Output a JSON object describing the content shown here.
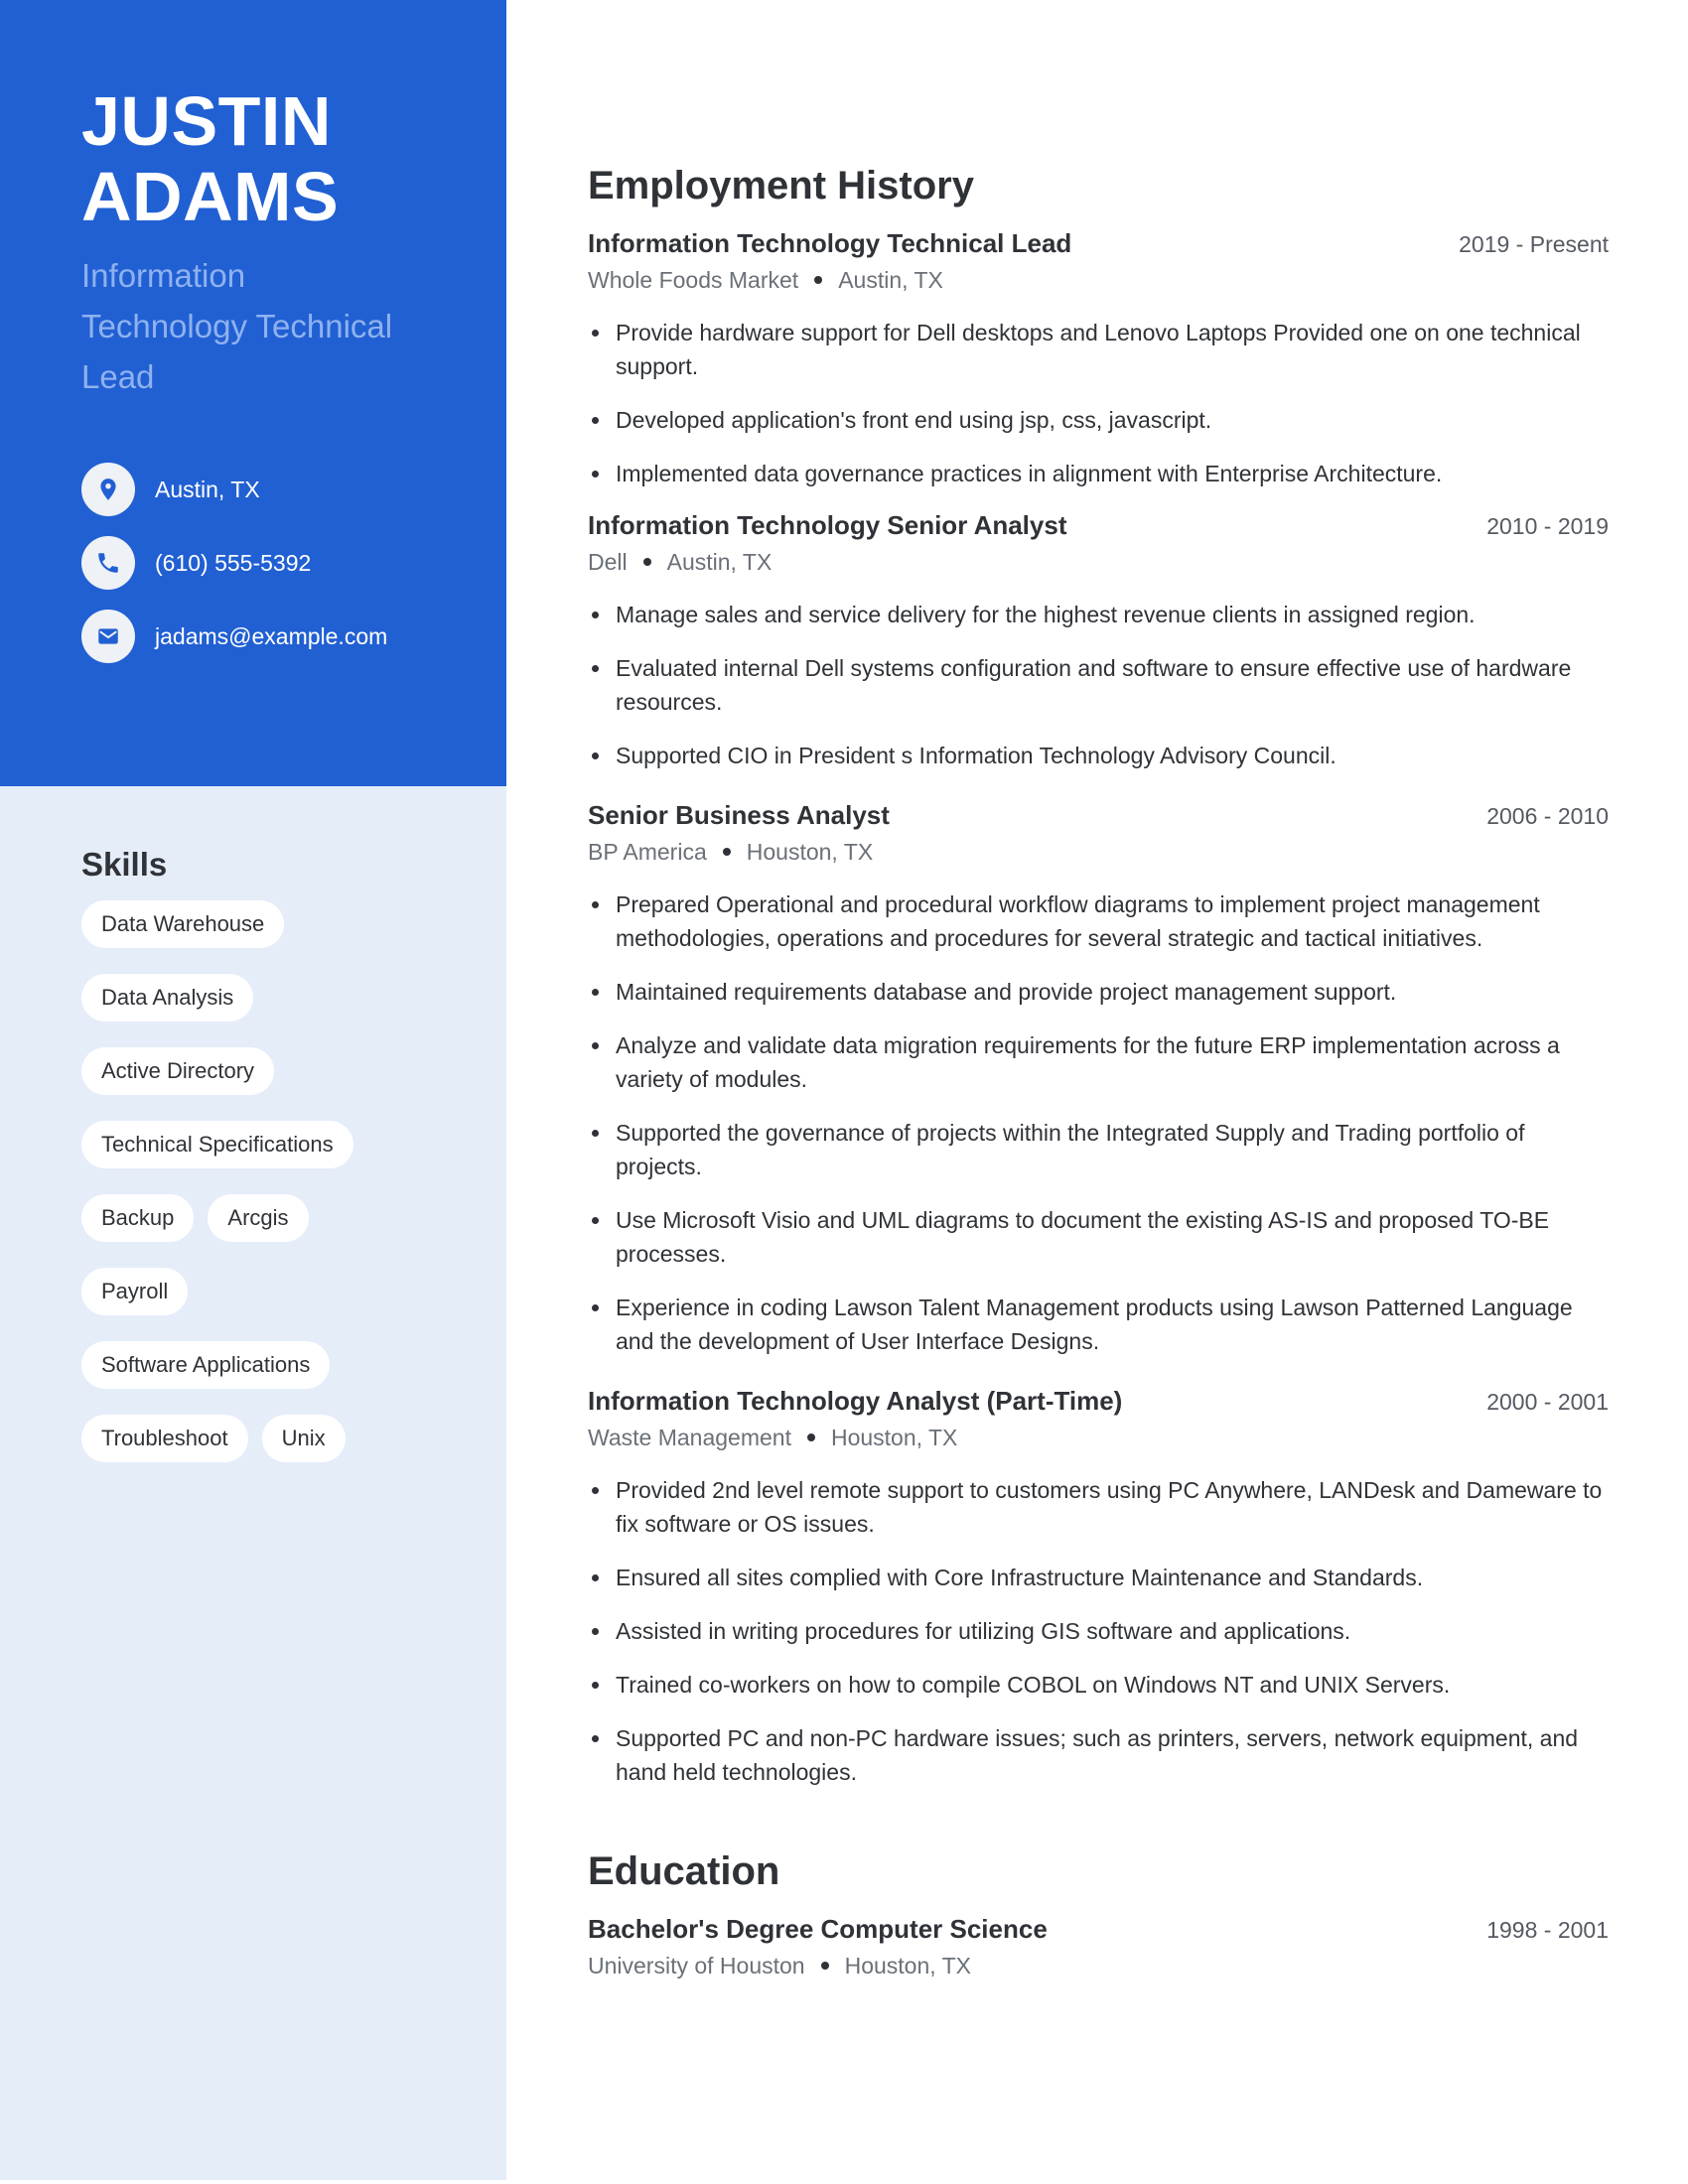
{
  "profile": {
    "name_first": "JUSTIN",
    "name_last": "ADAMS",
    "title": "Information Technology Technical Lead"
  },
  "contact": [
    {
      "icon": "location-pin-icon",
      "text": "Austin, TX"
    },
    {
      "icon": "phone-icon",
      "text": "(610) 555-5392"
    },
    {
      "icon": "mail-icon",
      "text": "jadams@example.com"
    }
  ],
  "skills": {
    "title": "Skills",
    "items": [
      "Data Warehouse",
      "Data Analysis",
      "Active Directory",
      "Technical Specifications",
      "Backup",
      "Arcgis",
      "Payroll",
      "Software Applications",
      "Troubleshoot",
      "Unix"
    ]
  },
  "employment": {
    "title": "Employment History",
    "jobs": [
      {
        "role": "Information Technology Technical Lead",
        "dates": "2019 - Present",
        "company": "Whole Foods Market",
        "location": "Austin, TX",
        "bullets": [
          "Provide hardware support for Dell desktops and Lenovo Laptops Provided one on one technical support.",
          "Developed application's front end using jsp, css, javascript.",
          "Implemented data governance practices in alignment with Enterprise Architecture."
        ]
      },
      {
        "role": "Information Technology Senior Analyst",
        "dates": "2010 - 2019",
        "company": "Dell",
        "location": "Austin, TX",
        "bullets": [
          "Manage sales and service delivery for the highest revenue clients in assigned region.",
          "Evaluated internal Dell systems configuration and software to ensure effective use of hardware resources.",
          "Supported CIO in President s Information Technology Advisory Council."
        ]
      },
      {
        "role": "Senior Business Analyst",
        "dates": "2006 - 2010",
        "company": "BP America",
        "location": "Houston, TX",
        "bullets": [
          "Prepared Operational and procedural workflow diagrams to implement project management methodologies, operations and procedures for several strategic and tactical initiatives.",
          "Maintained requirements database and provide project management support.",
          "Analyze and validate data migration requirements for the future ERP implementation across a variety of modules.",
          "Supported the governance of projects within the Integrated Supply and Trading portfolio of projects.",
          "Use Microsoft Visio and UML diagrams to document the existing AS-IS and proposed TO-BE processes.",
          "Experience in coding Lawson Talent Management products using Lawson Patterned Language and the development of User Interface Designs."
        ]
      },
      {
        "role": "Information Technology Analyst (Part-Time)",
        "dates": "2000 - 2001",
        "company": "Waste Management",
        "location": "Houston, TX",
        "bullets": [
          "Provided 2nd level remote support to customers using PC Anywhere, LANDesk and Dameware to fix software or OS issues.",
          "Ensured all sites complied with Core Infrastructure Maintenance and Standards.",
          "Assisted in writing procedures for utilizing GIS software and applications.",
          "Trained co-workers on how to compile COBOL on Windows NT and UNIX Servers.",
          "Supported PC and non-PC hardware issues; such as printers, servers, network equipment, and hand held technologies."
        ]
      }
    ]
  },
  "education": {
    "title": "Education",
    "entries": [
      {
        "degree": "Bachelor's Degree Computer Science",
        "dates": "1998 - 2001",
        "school": "University of Houston",
        "location": "Houston, TX"
      }
    ]
  },
  "colors": {
    "accent": "#2160d3",
    "sidebar_light": "#e5edf9",
    "title_muted": "#8fb2ef",
    "text": "#2f3237"
  }
}
